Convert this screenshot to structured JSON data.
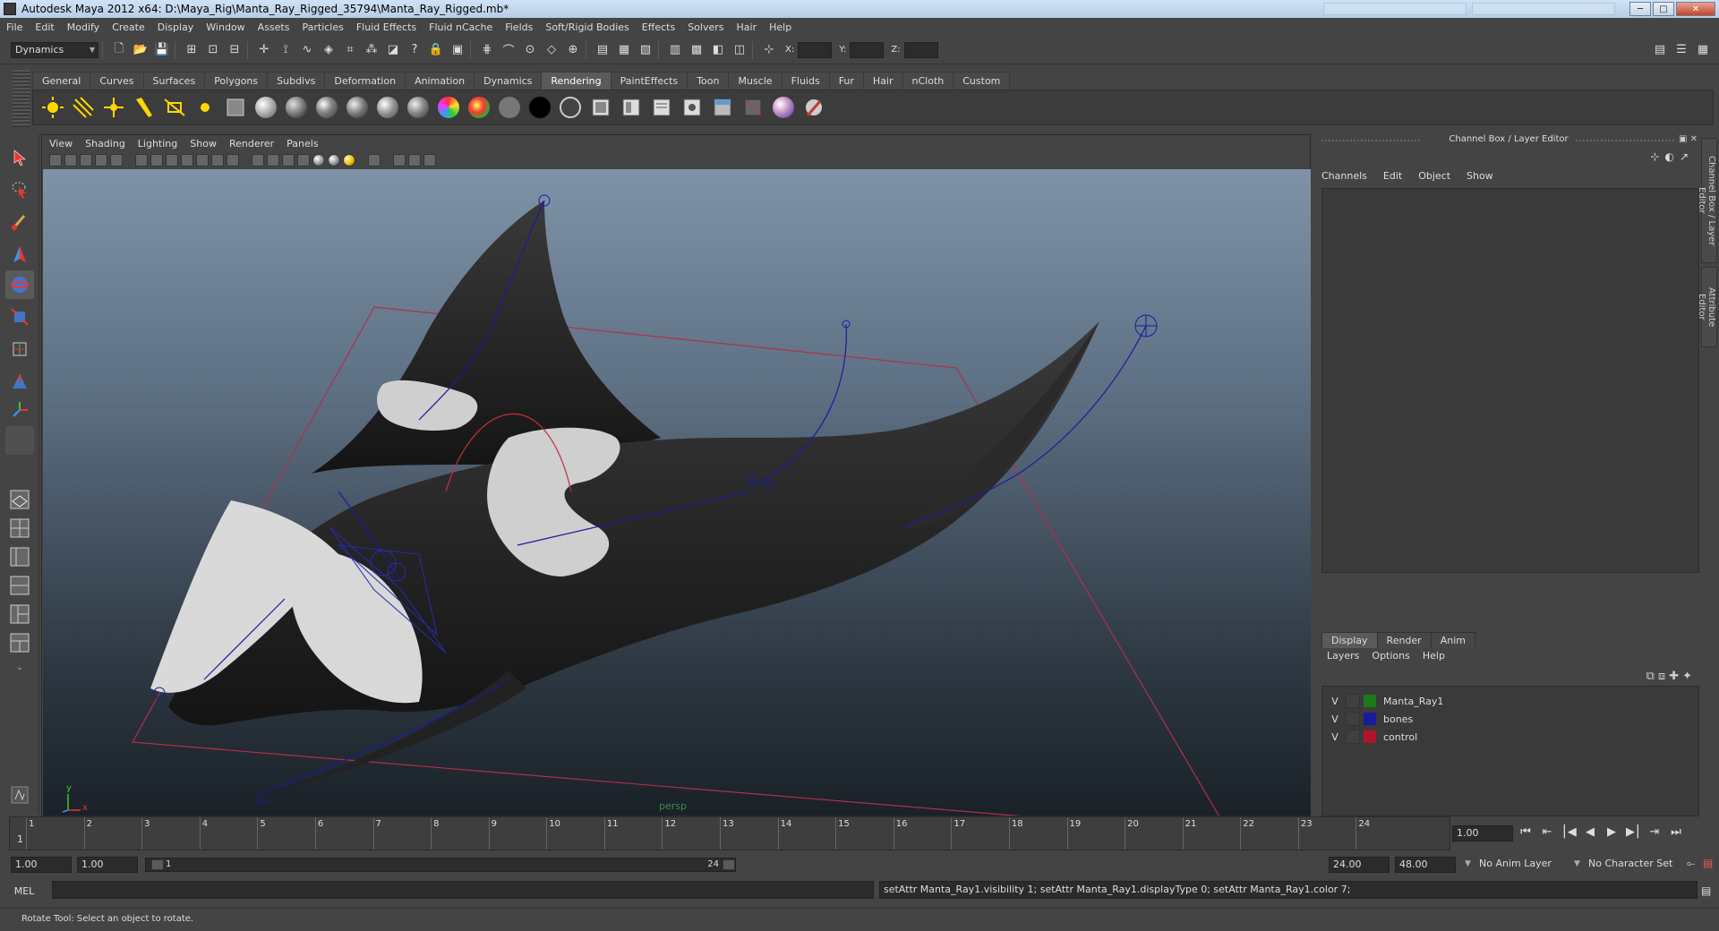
{
  "window": {
    "title": "Autodesk Maya 2012 x64: D:\\Maya_Rig\\Manta_Ray_Rigged_35794\\Manta_Ray_Rigged.mb*",
    "min": "─",
    "max": "□",
    "close": "✕"
  },
  "menubar": [
    "File",
    "Edit",
    "Modify",
    "Create",
    "Display",
    "Window",
    "Assets",
    "Particles",
    "Fluid Effects",
    "Fluid nCache",
    "Fields",
    "Soft/Rigid Bodies",
    "Effects",
    "Solvers",
    "Hair",
    "Help"
  ],
  "statusline": {
    "mode": "Dynamics",
    "x_label": "X:",
    "y_label": "Y:",
    "z_label": "Z:"
  },
  "shelf": {
    "tabs": [
      "General",
      "Curves",
      "Surfaces",
      "Polygons",
      "Subdivs",
      "Deformation",
      "Animation",
      "Dynamics",
      "Rendering",
      "PaintEffects",
      "Toon",
      "Muscle",
      "Fluids",
      "Fur",
      "Hair",
      "nCloth",
      "Custom"
    ],
    "active_tab": "Rendering"
  },
  "viewport": {
    "menu": [
      "View",
      "Shading",
      "Lighting",
      "Show",
      "Renderer",
      "Panels"
    ],
    "camera_label": "persp",
    "axis_y": "y",
    "axis_x": "x"
  },
  "channel_box": {
    "title": "Channel Box / Layer Editor",
    "menu": [
      "Channels",
      "Edit",
      "Object",
      "Show"
    ],
    "side_tabs": [
      "Channel Box / Layer Editor",
      "Attribute Editor"
    ]
  },
  "layer_editor": {
    "tabs": [
      "Display",
      "Render",
      "Anim"
    ],
    "active_tab": "Display",
    "menu": [
      "Layers",
      "Options",
      "Help"
    ],
    "layers": [
      {
        "visible": "V",
        "name": "Manta_Ray1",
        "color": "#1a7a1a"
      },
      {
        "visible": "V",
        "name": "bones",
        "color": "#1a1a9c"
      },
      {
        "visible": "V",
        "name": "control",
        "color": "#b0142a"
      }
    ]
  },
  "timeline": {
    "frames": [
      "1",
      "2",
      "3",
      "4",
      "5",
      "6",
      "7",
      "8",
      "9",
      "10",
      "11",
      "12",
      "13",
      "14",
      "15",
      "16",
      "17",
      "18",
      "19",
      "20",
      "21",
      "22",
      "23",
      "24"
    ],
    "current_frame_marker": "1",
    "current_time": "1.00"
  },
  "range": {
    "start_time": "1.00",
    "playback_start": "1.00",
    "slider_start": "1",
    "slider_end": "24",
    "playback_end": "24.00",
    "end_time": "48.00",
    "anim_layer": "No Anim Layer",
    "character_set": "No Character Set"
  },
  "command": {
    "label": "MEL",
    "output": "setAttr Manta_Ray1.visibility 1; setAttr Manta_Ray1.displayType 0; setAttr Manta_Ray1.color 7;"
  },
  "help_line": "Rotate Tool: Select an object to rotate."
}
